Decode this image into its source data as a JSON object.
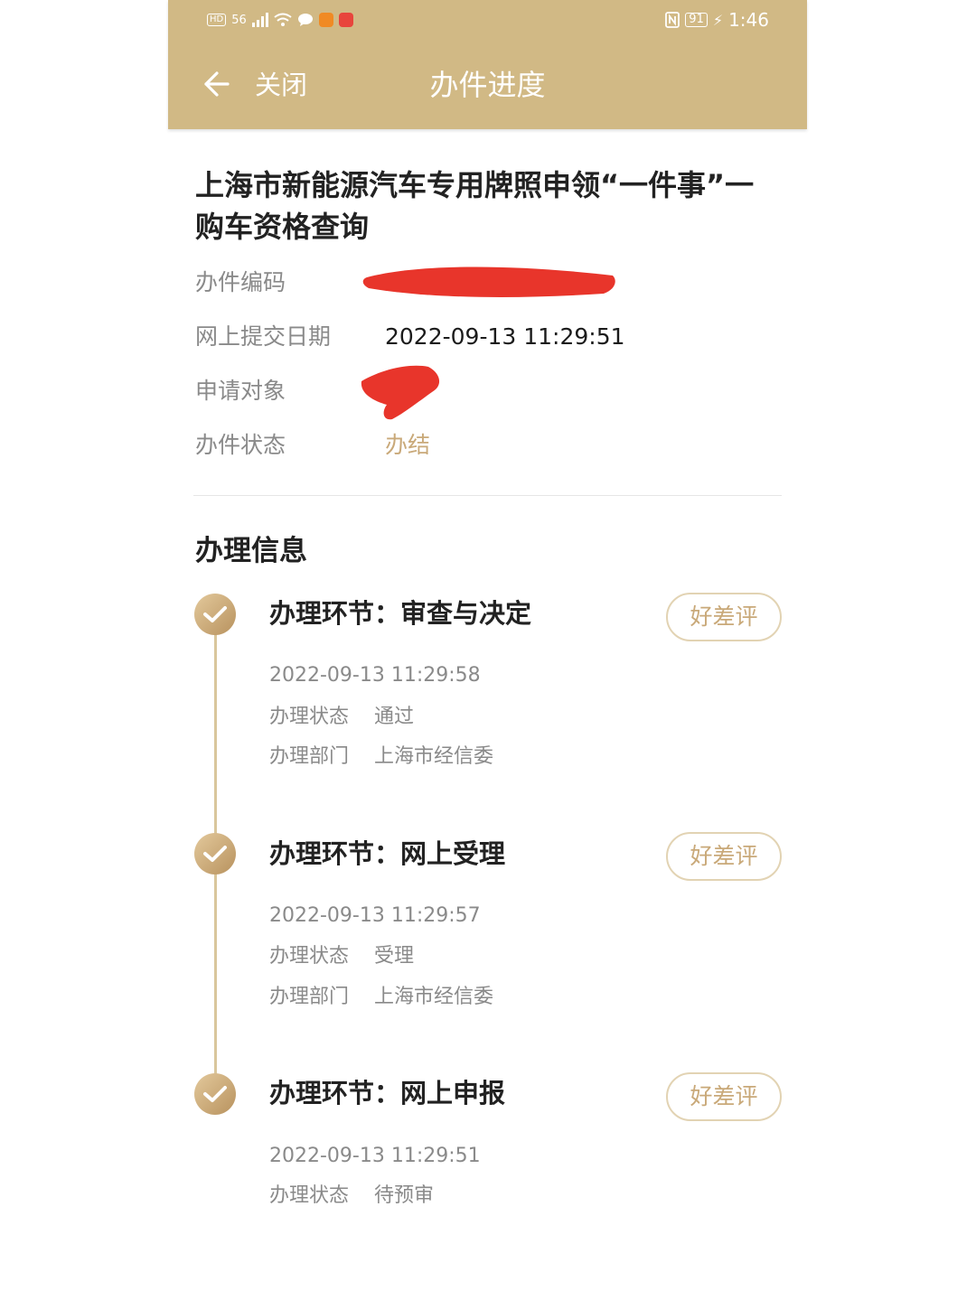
{
  "status_bar": {
    "network": "56",
    "battery": "91",
    "time": "1:46"
  },
  "nav": {
    "back_icon": "back-arrow-icon",
    "close_label": "关闭",
    "title": "办件进度"
  },
  "case": {
    "title": "上海市新能源汽车专用牌照申领“一件事”一购车资格查询",
    "rows": [
      {
        "label": "办件编码",
        "value": ""
      },
      {
        "label": "网上提交日期",
        "value": "2022-09-13 11:29:51"
      },
      {
        "label": "申请对象",
        "value": ""
      },
      {
        "label": "办件状态",
        "value": "办结"
      }
    ]
  },
  "section_title": "办理信息",
  "steps": [
    {
      "title": "办理环节：审查与决定",
      "rate_label": "好差评",
      "time": "2022-09-13 11:29:58",
      "rows": [
        {
          "k": "办理状态",
          "v": "通过"
        },
        {
          "k": "办理部门",
          "v": "上海市经信委"
        }
      ]
    },
    {
      "title": "办理环节：网上受理",
      "rate_label": "好差评",
      "time": "2022-09-13 11:29:57",
      "rows": [
        {
          "k": "办理状态",
          "v": "受理"
        },
        {
          "k": "办理部门",
          "v": "上海市经信委"
        }
      ]
    },
    {
      "title": "办理环节：网上申报",
      "rate_label": "好差评",
      "time": "2022-09-13 11:29:51",
      "rows": [
        {
          "k": "办理状态",
          "v": "待预审"
        }
      ]
    }
  ],
  "colors": {
    "header_gold": "#d1b985",
    "accent_gold": "#c9a979",
    "redaction_red": "#e8352b"
  }
}
